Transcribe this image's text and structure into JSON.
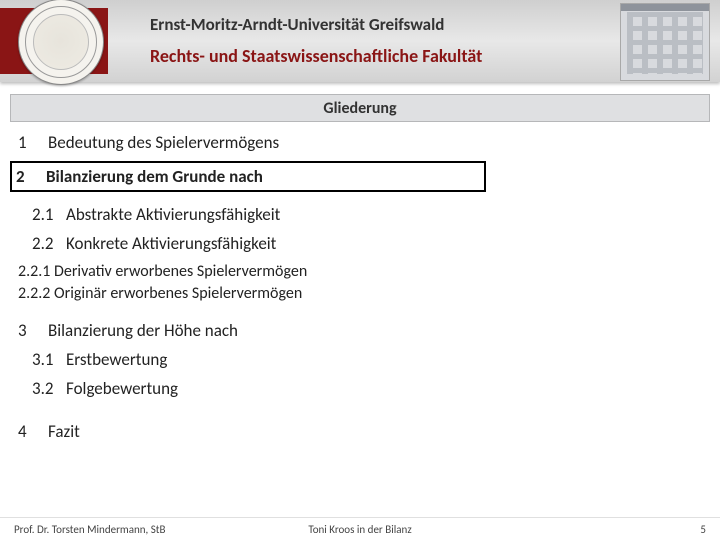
{
  "header": {
    "university": "Ernst-Moritz-Arndt-Universität Greifswald",
    "faculty": "Rechts- und Staatswissenschaftliche Fakultät"
  },
  "title": "Gliederung",
  "items": {
    "n1": "1",
    "t1": "Bedeutung des Spielervermögens",
    "n2": "2",
    "t2": "Bilanzierung dem Grunde nach",
    "n21": "2.1",
    "t21": "Abstrakte Aktivierungsfähigkeit",
    "n22": "2.2",
    "t22": "Konkrete Aktivierungsfähigkeit",
    "t221": "2.2.1 Derivativ erworbenes Spielervermögen",
    "t222": "2.2.2 Originär erworbenes Spielervermögen",
    "n3": "3",
    "t3": "Bilanzierung der Höhe nach",
    "n31": "3.1",
    "t31": "Erstbewertung",
    "n32": "3.2",
    "t32": "Folgebewertung",
    "n4": "4",
    "t4": "Fazit"
  },
  "footer": {
    "left": "Prof. Dr. Torsten Mindermann, StB",
    "center": "Toni Kroos in der Bilanz",
    "right": "5"
  }
}
